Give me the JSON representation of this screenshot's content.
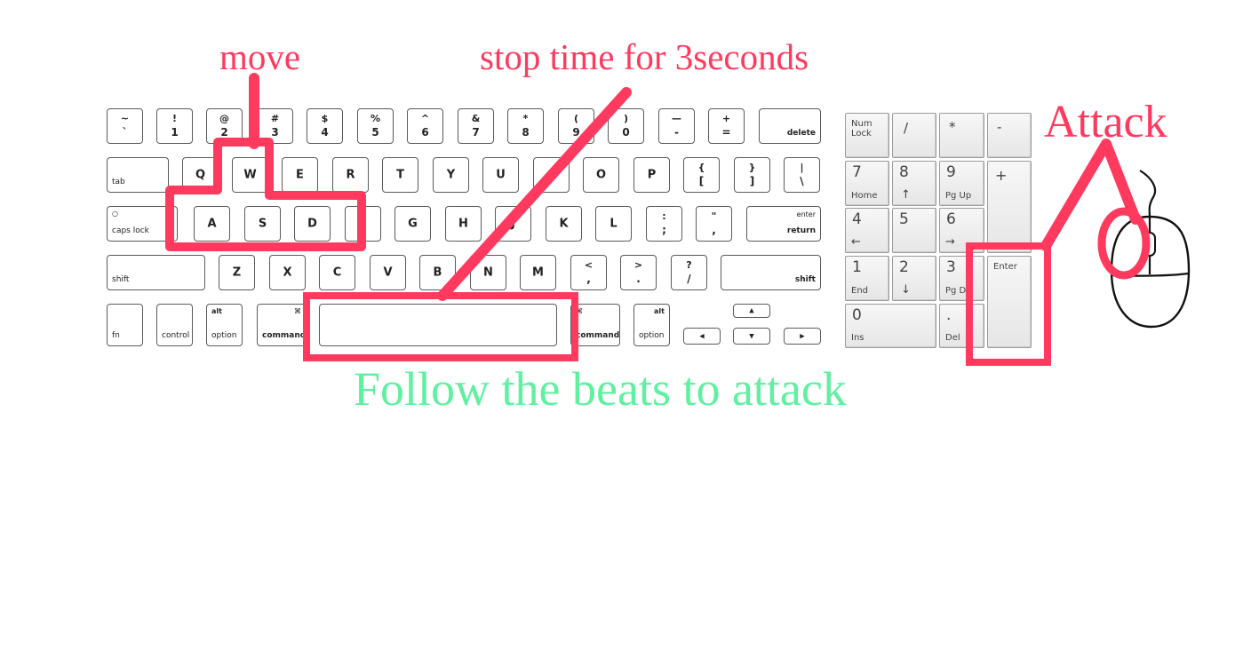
{
  "annotations": {
    "move": "move",
    "stop_time": "stop time for 3seconds",
    "attack": "Attack",
    "follow_beats": "Follow the beats to attack"
  },
  "colors": {
    "highlight": "#ff3a5e",
    "annotation_red": "#ff3a5e",
    "annotation_green": "#5ff0a0",
    "key_border": "#5a5a5a"
  },
  "keyboard": {
    "row1": [
      {
        "top": "~",
        "bottom": "`"
      },
      {
        "top": "!",
        "bottom": "1"
      },
      {
        "top": "@",
        "bottom": "2"
      },
      {
        "top": "#",
        "bottom": "3"
      },
      {
        "top": "$",
        "bottom": "4"
      },
      {
        "top": "%",
        "bottom": "5"
      },
      {
        "top": "^",
        "bottom": "6"
      },
      {
        "top": "&",
        "bottom": "7"
      },
      {
        "top": "*",
        "bottom": "8"
      },
      {
        "top": "(",
        "bottom": "9"
      },
      {
        "top": ")",
        "bottom": "0"
      },
      {
        "top": "—",
        "bottom": "-"
      },
      {
        "top": "+",
        "bottom": "="
      }
    ],
    "delete": "delete",
    "tab": "tab",
    "row2": [
      "Q",
      "W",
      "E",
      "R",
      "T",
      "Y",
      "U",
      "I",
      "O",
      "P"
    ],
    "row2_sym": [
      {
        "top": "{",
        "bottom": "["
      },
      {
        "top": "}",
        "bottom": "]"
      },
      {
        "top": "|",
        "bottom": "\\"
      }
    ],
    "caps_lock": "caps lock",
    "caps_dot": "○",
    "row3": [
      "A",
      "S",
      "D",
      "F",
      "G",
      "H",
      "J",
      "K",
      "L"
    ],
    "row3_sym": [
      {
        "top": ":",
        "bottom": ";"
      },
      {
        "top": "\"",
        "bottom": ","
      }
    ],
    "enter_top": "enter",
    "enter_bottom": "return",
    "shift_left": "shift",
    "row4": [
      "Z",
      "X",
      "C",
      "V",
      "B",
      "N",
      "M"
    ],
    "row4_sym": [
      {
        "top": "<",
        "bottom": ","
      },
      {
        "top": ">",
        "bottom": "."
      },
      {
        "top": "?",
        "bottom": "/"
      }
    ],
    "shift_right": "shift",
    "fn": "fn",
    "control": "control",
    "alt": "alt",
    "option": "option",
    "command": "command",
    "cmd_glyph": "⌘",
    "arrow_up": "▲",
    "arrow_left": "◀",
    "arrow_down": "▼",
    "arrow_right": "▶"
  },
  "numpad": {
    "num_lock": "Num\nLock",
    "slash": "/",
    "star": "*",
    "minus": "-",
    "plus": "+",
    "k7": "7",
    "k7_sub": "Home",
    "k8": "8",
    "k8_sub": "↑",
    "k9": "9",
    "k9_sub": "Pg Up",
    "k4": "4",
    "k4_sub": "←",
    "k5": "5",
    "k6": "6",
    "k6_sub": "→",
    "k1": "1",
    "k1_sub": "End",
    "k2": "2",
    "k2_sub": "↓",
    "k3": "3",
    "k3_sub": "Pg Dn",
    "enter": "Enter",
    "k0": "0",
    "k0_sub": "Ins",
    "dot": ".",
    "dot_sub": "Del"
  }
}
